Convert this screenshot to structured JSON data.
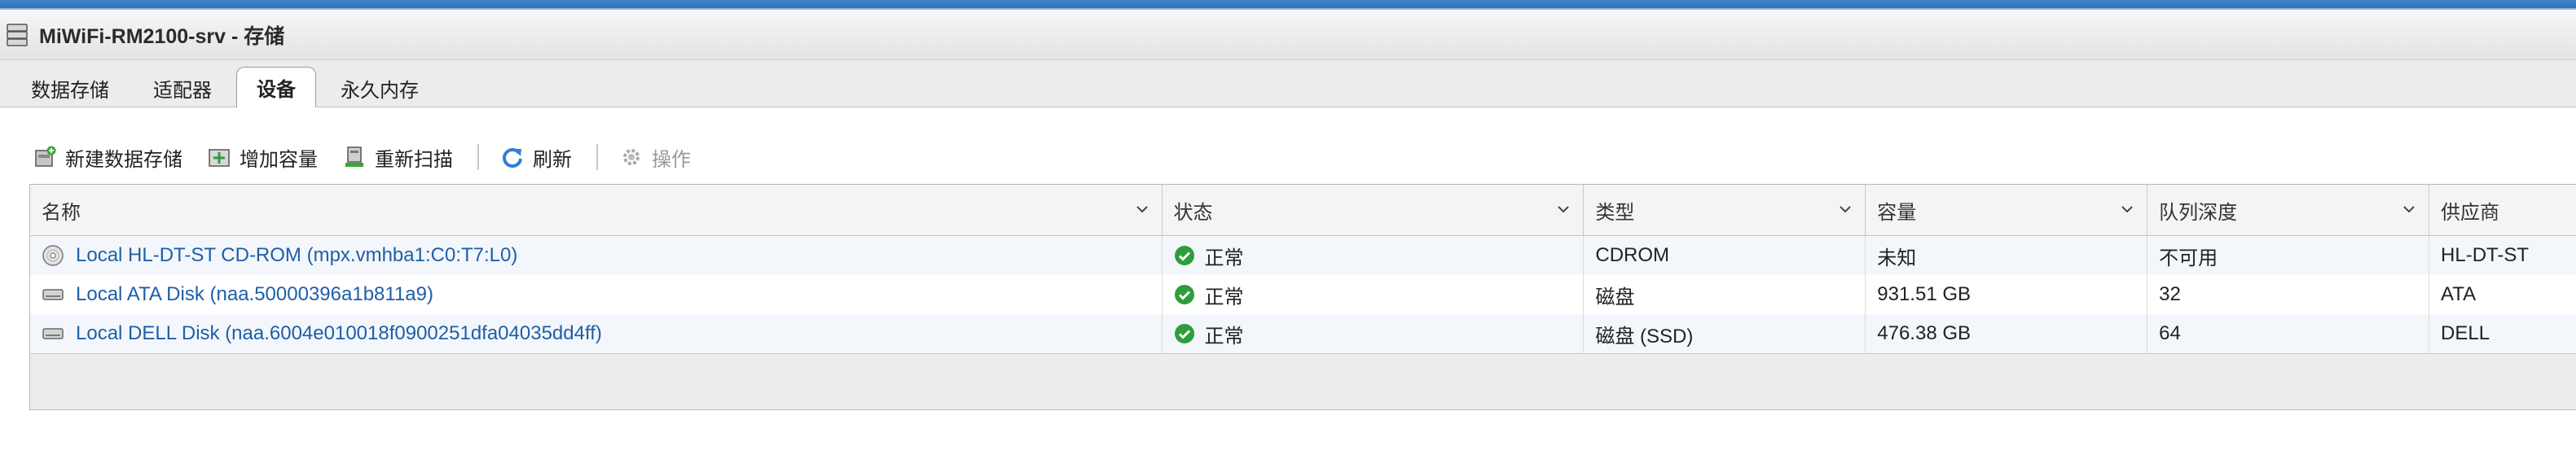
{
  "window": {
    "title": "MiWiFi-RM2100-srv - 存储"
  },
  "tabs": [
    {
      "label": "数据存储",
      "active": false
    },
    {
      "label": "适配器",
      "active": false
    },
    {
      "label": "设备",
      "active": true
    },
    {
      "label": "永久内存",
      "active": false
    }
  ],
  "toolbar": {
    "new_datastore": "新建数据存储",
    "increase_capacity": "增加容量",
    "rescan": "重新扫描",
    "refresh": "刷新",
    "actions": "操作"
  },
  "table": {
    "columns": [
      "名称",
      "状态",
      "类型",
      "容量",
      "队列深度",
      "供应商"
    ],
    "rows": [
      {
        "name": "Local HL-DT-ST CD-ROM (mpx.vmhba1:C0:T7:L0)",
        "icon": "cdrom-icon",
        "status": "正常",
        "type": "CDROM",
        "capacity": "未知",
        "queue_depth": "不可用",
        "vendor": "HL-DT-ST"
      },
      {
        "name": "Local ATA Disk (naa.50000396a1b811a9)",
        "icon": "disk-icon",
        "status": "正常",
        "type": "磁盘",
        "capacity": "931.51 GB",
        "queue_depth": "32",
        "vendor": "ATA"
      },
      {
        "name": "Local DELL Disk (naa.6004e010018f0900251dfa04035dd4ff)",
        "icon": "disk-icon",
        "status": "正常",
        "type": "磁盘 (SSD)",
        "capacity": "476.38 GB",
        "queue_depth": "64",
        "vendor": "DELL"
      }
    ]
  },
  "colors": {
    "accent": "#1f5ea8",
    "status_ok": "#2e9e3a",
    "refresh_blue": "#2f7fd1"
  }
}
